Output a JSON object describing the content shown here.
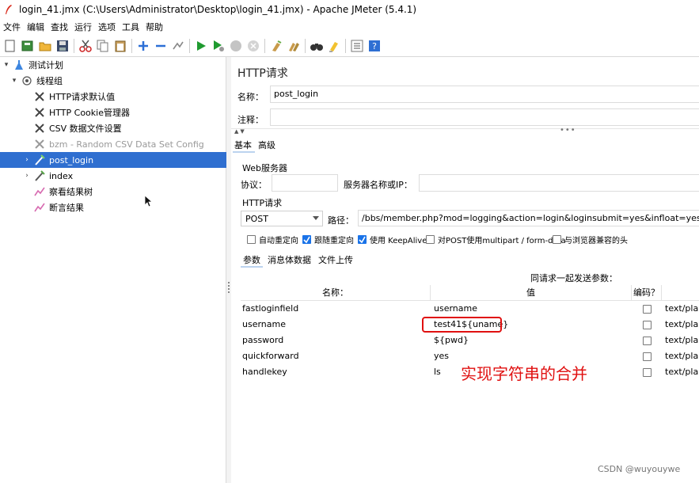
{
  "window": {
    "title": "login_41.jmx (C:\\Users\\Administrator\\Desktop\\login_41.jmx) - Apache JMeter (5.4.1)"
  },
  "menu": [
    "文件",
    "编辑",
    "查找",
    "运行",
    "选项",
    "工具",
    "帮助"
  ],
  "toolbar": {
    "icons": [
      "new-icon",
      "templates-icon",
      "open-icon",
      "save-icon",
      "cut-icon",
      "copy-icon",
      "paste-icon",
      "expand-icon",
      "collapse-icon",
      "toggle-icon",
      "start-icon",
      "start-no-pause-icon",
      "stop-icon",
      "shutdown-icon",
      "clear-icon",
      "clear-all-icon",
      "search-icon",
      "reset-search-icon",
      "function-helper-icon",
      "help-icon"
    ]
  },
  "tree": {
    "items": [
      {
        "label": "测试计划",
        "level": 0,
        "toggle": "▾",
        "icon": "test-plan-icon"
      },
      {
        "label": "线程组",
        "level": 1,
        "toggle": "▾",
        "icon": "thread-group-icon"
      },
      {
        "label": "HTTP请求默认值",
        "level": 2,
        "toggle": "",
        "icon": "config-wrench-icon"
      },
      {
        "label": "HTTP Cookie管理器",
        "level": 2,
        "toggle": "",
        "icon": "config-wrench-icon"
      },
      {
        "label": "CSV 数据文件设置",
        "level": 2,
        "toggle": "",
        "icon": "config-wrench-icon"
      },
      {
        "label": "bzm - Random CSV Data Set Config",
        "level": 2,
        "toggle": "",
        "icon": "config-wrench-icon",
        "disabled": true
      },
      {
        "label": "post_login",
        "level": 2,
        "toggle": "›",
        "icon": "sampler-icon",
        "selected": true
      },
      {
        "label": "index",
        "level": 2,
        "toggle": "›",
        "icon": "sampler-icon"
      },
      {
        "label": "察看结果树",
        "level": 2,
        "toggle": "",
        "icon": "listener-icon"
      },
      {
        "label": "断言结果",
        "level": 2,
        "toggle": "",
        "icon": "listener-icon"
      }
    ]
  },
  "panel": {
    "title": "HTTP请求",
    "name_label": "名称：",
    "name_value": "post_login",
    "comment_label": "注释：",
    "comment_value": "",
    "subtabs": [
      "基本",
      "高级"
    ],
    "web_server_label": "Web服务器",
    "protocol_label": "协议：",
    "protocol_value": "",
    "server_label": "服务器名称或IP：",
    "server_value": "",
    "http_request_label": "HTTP请求",
    "method": "POST",
    "path_label": "路径：",
    "path_value": "/bbs/member.php?mod=logging&action=login&loginsubmit=yes&infloat=yes&lss",
    "checkboxes": [
      {
        "label": "自动重定向",
        "checked": false
      },
      {
        "label": "跟随重定向",
        "checked": true
      },
      {
        "label": "使用 KeepAlive",
        "checked": true
      },
      {
        "label": "对POST使用multipart / form-data",
        "checked": false
      },
      {
        "label": "与浏览器兼容的头",
        "checked": false
      }
    ],
    "param_tabs": [
      "参数",
      "消息体数据",
      "文件上传"
    ],
    "send_params_label": "同请求一起发送参数：",
    "table": {
      "headers": [
        "名称：",
        "值",
        "编码？",
        ""
      ],
      "rows": [
        {
          "name": "fastloginfield",
          "value": "username",
          "encode": false,
          "content_type": "text/plain"
        },
        {
          "name": "username",
          "value": "test41${uname}",
          "encode": false,
          "content_type": "text/plain"
        },
        {
          "name": "password",
          "value": "${pwd}",
          "encode": false,
          "content_type": "text/plain"
        },
        {
          "name": "quickforward",
          "value": "yes",
          "encode": false,
          "content_type": "text/plain"
        },
        {
          "name": "handlekey",
          "value": "ls",
          "encode": false,
          "content_type": "text/plain"
        }
      ]
    }
  },
  "annotation": {
    "text": "实现字符串的合并",
    "color": "#e01010"
  },
  "watermark": "CSDN @wuyouywe",
  "colors": {
    "selection": "#2f6fd0",
    "accent_checkbox": "#1a73e8"
  }
}
